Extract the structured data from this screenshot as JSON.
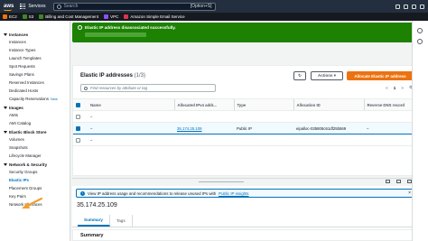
{
  "topnav": {
    "logo": "aws",
    "services_label": "Services",
    "search_placeholder": "Search",
    "search_hint": "[Option+S]"
  },
  "favorites": [
    {
      "label": "EC2",
      "color": "#ec7211",
      "icon": "ec2-icon"
    },
    {
      "label": "S3",
      "color": "#3f8624",
      "icon": "s3-icon"
    },
    {
      "label": "Billing and Cost Management",
      "color": "#3f8624",
      "icon": "billing-icon"
    },
    {
      "label": "VPC",
      "color": "#8c4fff",
      "icon": "vpc-icon"
    },
    {
      "label": "Amazon Simple Email Service",
      "color": "#dd344c",
      "icon": "ses-icon"
    }
  ],
  "sidebar": {
    "sections": [
      {
        "title": "Instances",
        "items": [
          "Instances",
          "Instance Types",
          "Launch Templates",
          "Spot Requests",
          "Savings Plans",
          "Reserved Instances",
          "Dedicated Hosts",
          "Capacity Reservations"
        ]
      },
      {
        "title": "Images",
        "items": [
          "AMIs",
          "AMI Catalog"
        ]
      },
      {
        "title": "Elastic Block Store",
        "items": [
          "Volumes",
          "Snapshots",
          "Lifecycle Manager"
        ]
      },
      {
        "title": "Network & Security",
        "items": [
          "Security Groups",
          "Elastic IPs",
          "Placement Groups",
          "Key Pairs",
          "Network Interfaces"
        ]
      }
    ],
    "new_badge": "New",
    "active_item": "Elastic IPs"
  },
  "flash": {
    "message": "Elastic IP address disassociated successfully.",
    "close": "×"
  },
  "panel": {
    "title": "Elastic IP addresses",
    "count": "(1/3)",
    "refresh": "↻",
    "actions_label": "Actions ▾",
    "allocate_label": "Allocate Elastic IP address",
    "filter_placeholder": "Find resources by attribute or tag",
    "page_prev": "<",
    "page_current": "1",
    "page_next": ">",
    "settings": "⚙"
  },
  "table": {
    "headers": [
      "Name",
      "Allocated IPv4 addr...",
      "Type",
      "Allocation ID",
      "Reverse DNS record"
    ],
    "rows": [
      {
        "name": "–",
        "ip": "",
        "type": "",
        "allocation_id": "",
        "dns": "",
        "selected": false
      },
      {
        "name": "–",
        "ip": "35.174.25.109",
        "type": "Public IP",
        "allocation_id": "eipalloc-035808c61df25b569",
        "dns": "–",
        "selected": true
      },
      {
        "name": "–",
        "ip": "",
        "type": "",
        "allocation_id": "",
        "dns": "",
        "selected": false
      }
    ]
  },
  "detail": {
    "info_text": "View IP address usage and recommendations to release unused IPs with",
    "info_link": "Public IP insights",
    "info_close": "×",
    "ip_title": "35.174.25.109",
    "tabs": [
      "Summary",
      "Tags"
    ],
    "summary_heading": "Summary"
  },
  "colors": {
    "nav": "#232f3e",
    "success": "#1d8102",
    "primary": "#ec7211",
    "link": "#0073bb"
  }
}
